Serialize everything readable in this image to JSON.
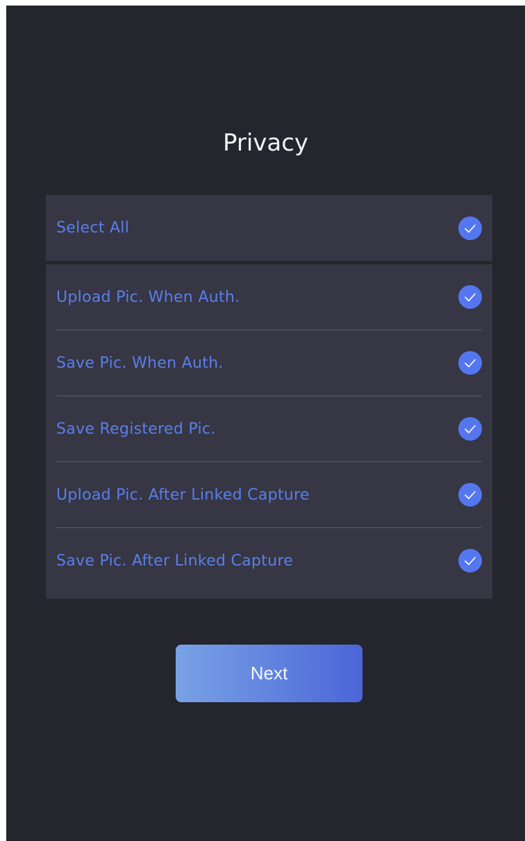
{
  "page": {
    "title": "Privacy",
    "next_label": "Next"
  },
  "select_all": {
    "label": "Select All",
    "checked": true,
    "icon": "checkmark-circle-icon"
  },
  "options": [
    {
      "label": "Upload Pic. When Auth.",
      "checked": true,
      "icon": "checkmark-circle-icon"
    },
    {
      "label": "Save Pic. When Auth.",
      "checked": true,
      "icon": "checkmark-circle-icon"
    },
    {
      "label": "Save Registered Pic.",
      "checked": true,
      "icon": "checkmark-circle-icon"
    },
    {
      "label": "Upload Pic. After Linked Capture",
      "checked": true,
      "icon": "checkmark-circle-icon"
    },
    {
      "label": "Save Pic. After Linked Capture",
      "checked": true,
      "icon": "checkmark-circle-icon"
    }
  ],
  "colors": {
    "background": "#25252d",
    "panel": "#363645",
    "label": "#5a7fea",
    "check": "#5477f0",
    "button_start": "#79a3e6",
    "button_end": "#4b65d8"
  }
}
